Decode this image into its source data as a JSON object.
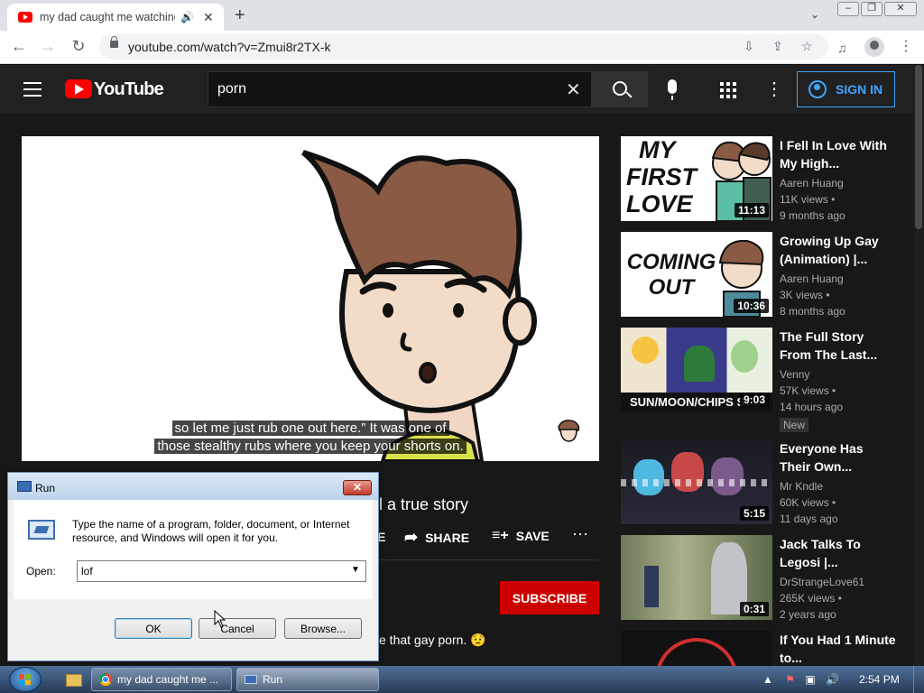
{
  "browser": {
    "tab_title": "my dad caught me watching gay porn",
    "tab_audio_icon": "speaker-icon",
    "new_tab_label": "+",
    "url": "youtube.com/watch?v=Zmui8r2TX-k"
  },
  "youtube": {
    "logo_text": "YouTube",
    "search_value": "porn",
    "sign_in_label": "SIGN IN"
  },
  "video": {
    "caption_line1": "so let me just rub one out here.” It was one of",
    "caption_line2": "those stealthy rubs where you keep your shorts on.",
    "title_fragment": "l a true story",
    "action_e": "E",
    "share_label": "SHARE",
    "save_label": "SAVE",
    "subscribe_label": "SUBSCRIBE",
    "desc_fragment": "e that gay porn. 😟",
    "thumb_text_1": "MY",
    "thumb_text_2": "FIRST",
    "thumb_text_3": "LOVE"
  },
  "recommendations": [
    {
      "title": "I Fell In Love With My High...",
      "channel": "Aaren Huang",
      "views": "11K views •",
      "age": "9 months ago",
      "duration": "11:13",
      "thumb_text": "MY FIRST LOVE"
    },
    {
      "title": "Growing Up Gay (Animation) |...",
      "channel": "Aaren Huang",
      "views": "3K views •",
      "age": "8 months ago",
      "duration": "10:36",
      "thumb_text": "COMING OUT"
    },
    {
      "title": "The Full Story From The Last...",
      "channel": "Venny",
      "views": "57K views •",
      "age": "14 hours ago",
      "duration": "9:03",
      "thumb_text": "SUN/MOON/CHIPS ST...",
      "badge": "New"
    },
    {
      "title": "Everyone Has Their Own...",
      "channel": "Mr Kndle",
      "views": "60K views •",
      "age": "11 days ago",
      "duration": "5:15"
    },
    {
      "title": "Jack Talks To Legosi |...",
      "channel": "DrStrangeLove61",
      "views": "265K views •",
      "age": "2 years ago",
      "duration": "0:31"
    },
    {
      "title": "If You Had 1 Minute to..."
    }
  ],
  "run_dialog": {
    "title": "Run",
    "description": "Type the name of a program, folder, document, or Internet resource, and Windows will open it for you.",
    "open_label": "Open:",
    "input_value": "lof",
    "ok_label": "OK",
    "cancel_label": "Cancel",
    "browse_label": "Browse..."
  },
  "taskbar": {
    "chrome_item": "my dad caught me ...",
    "run_item": "Run",
    "clock": "2:54 PM"
  }
}
